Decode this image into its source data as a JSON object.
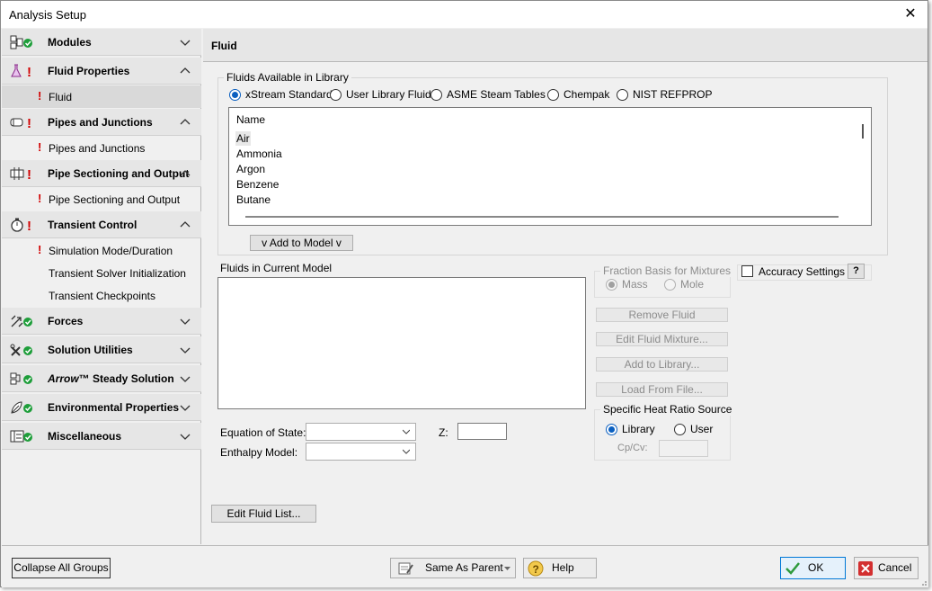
{
  "window": {
    "title": "Analysis Setup",
    "close_glyph": "✕"
  },
  "sidebar": {
    "groups": [
      {
        "label": "Modules",
        "icon": "modules-icon",
        "status": "ok",
        "expanded": false
      },
      {
        "label": "Fluid Properties",
        "icon": "flask-icon",
        "status": "error",
        "expanded": true
      },
      {
        "label": "Pipes and Junctions",
        "icon": "pipes-icon",
        "status": "error",
        "expanded": true
      },
      {
        "label": "Pipe Sectioning and Output",
        "icon": "pipe-sectioning-icon",
        "status": "error",
        "expanded": true
      },
      {
        "label": "Transient Control",
        "icon": "stopwatch-icon",
        "status": "error",
        "expanded": true
      },
      {
        "label": "Forces",
        "icon": "forces-icon",
        "status": "ok",
        "expanded": false
      },
      {
        "label": "Solution Utilities",
        "icon": "utilities-icon",
        "status": "ok",
        "expanded": false
      },
      {
        "label": "™ Steady Solution",
        "brand": "Arrow",
        "icon": "steady-solution-icon",
        "status": "ok",
        "expanded": false
      },
      {
        "label": "Environmental Properties",
        "icon": "environment-icon",
        "status": "ok",
        "expanded": false
      },
      {
        "label": "Miscellaneous",
        "icon": "miscellaneous-icon",
        "status": "ok",
        "expanded": false
      }
    ],
    "items": {
      "fluid": "Fluid",
      "pipes_and_junctions": "Pipes and Junctions",
      "pipe_sectioning_and_output": "Pipe Sectioning and Output",
      "simulation_mode_duration": "Simulation Mode/Duration",
      "transient_solver_initialization": "Transient Solver Initialization",
      "transient_checkpoints": "Transient Checkpoints"
    },
    "error_glyph": "!"
  },
  "panel": {
    "title": "Fluid",
    "library": {
      "legend": "Fluids Available in Library",
      "sources": [
        {
          "label": "xStream Standard",
          "checked": true
        },
        {
          "label": "User Library Fluid",
          "checked": false
        },
        {
          "label": "ASME Steam Tables",
          "checked": false
        },
        {
          "label": "Chempak",
          "checked": false
        },
        {
          "label": "NIST REFPROP",
          "checked": false
        }
      ],
      "column_header": "Name",
      "fluids": [
        "Air",
        "Ammonia",
        "Argon",
        "Benzene",
        "Butane"
      ],
      "selected_fluid": "Air",
      "add_button": "v  Add to Model  v"
    },
    "current_model": {
      "label": "Fluids in Current Model"
    },
    "fraction_basis": {
      "legend": "Fraction Basis for Mixtures",
      "options": [
        {
          "label": "Mass",
          "checked": true
        },
        {
          "label": "Mole",
          "checked": false
        }
      ]
    },
    "accuracy": {
      "label": "Accuracy Settings",
      "help": "?"
    },
    "actions": {
      "remove_fluid": "Remove Fluid",
      "edit_mixture": "Edit Fluid Mixture...",
      "add_to_library": "Add to Library...",
      "load_from_file": "Load From File..."
    },
    "specific_heat": {
      "legend": "Specific Heat Ratio Source",
      "options": [
        {
          "label": "Library",
          "checked": true
        },
        {
          "label": "User",
          "checked": false
        }
      ],
      "cpcv_label": "Cp/Cv:"
    },
    "equation_of_state": {
      "label": "Equation of State:",
      "value": ""
    },
    "enthalpy_model": {
      "label": "Enthalpy Model:",
      "value": ""
    },
    "z": {
      "label": "Z:",
      "value": ""
    },
    "edit_fluid_list": "Edit Fluid List..."
  },
  "footer": {
    "collapse_all": "Collapse All Groups",
    "same_as_parent": "Same As Parent",
    "help": "Help",
    "ok": "OK",
    "cancel": "Cancel"
  },
  "colors": {
    "error": "#d10000",
    "ok": "#1e9e3a",
    "accent": "#0a5fc0",
    "cancel_red": "#d32f2f"
  }
}
